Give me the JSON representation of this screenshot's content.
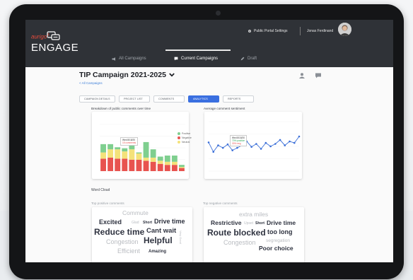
{
  "app": {
    "brand_small": "aurigo",
    "brand_big": "ENGAGE",
    "settings_label": "Public Portal Settings",
    "user_name": "Jonas Ferdinand"
  },
  "nav": {
    "tabs": [
      {
        "label": "All Campaigns"
      },
      {
        "label": "Current Campaigns"
      },
      {
        "label": "Draft"
      }
    ],
    "active_tab": 1
  },
  "page": {
    "title": "TIP Campaign 2021-2025",
    "back_link": "< All Campaigns",
    "pills": [
      "CAMPAIGN DETAILS",
      "PROJECT LIST",
      "COMMENTS",
      "ANALYTICS",
      "REPORTS"
    ],
    "active_pill": 3
  },
  "sections": {
    "breakdown_title": "Breakdown of public comments over time",
    "sentiment_title": "Average comment sentiment",
    "word_cloud_title": "Word Cloud",
    "top_positive_title": "Top positive comments",
    "top_negative_title": "Top negative comments"
  },
  "colors": {
    "positive": "#7fcf8f",
    "negative": "#e8534f",
    "neutral": "#f4e27a",
    "accent": "#3a6fe0",
    "line": "#3b6fd8"
  },
  "chart_data": [
    {
      "type": "bar",
      "stacked": true,
      "title": "Breakdown of public comments over time",
      "legend": [
        "Positive",
        "Negative",
        "Neutral"
      ],
      "legend_placement": "top-right",
      "series": [
        {
          "name": "Negative",
          "values": [
            12,
            13,
            12,
            12,
            11,
            11,
            10,
            9,
            7,
            6,
            6,
            3
          ]
        },
        {
          "name": "Neutral",
          "values": [
            6,
            8,
            9,
            7,
            10,
            6,
            3,
            4,
            3,
            3,
            3,
            1
          ]
        },
        {
          "name": "Positive",
          "values": [
            8,
            5,
            2,
            3,
            4,
            1,
            15,
            8,
            4,
            6,
            6,
            2
          ]
        }
      ],
      "ylim": [
        0,
        45
      ],
      "tooltip": {
        "line1": "Wed 8/18/20",
        "line2": "15 comments"
      }
    },
    {
      "type": "line",
      "title": "Average comment sentiment",
      "values": [
        0.58,
        0.39,
        0.52,
        0.47,
        0.54,
        0.42,
        0.47,
        0.52,
        0.6,
        0.49,
        0.55,
        0.45,
        0.57,
        0.5,
        0.55,
        0.63,
        0.52,
        0.6,
        0.57,
        0.7
      ],
      "ylim": [
        0,
        1
      ],
      "tooltip": {
        "line1": "Wed 8/18/20",
        "line2": "70% positive",
        "line3": "30% neg"
      }
    }
  ],
  "word_clouds": {
    "positive": [
      "Commute",
      "Excited",
      "Glad",
      "Short",
      "Drive time",
      "Reduce time",
      "Cant wait",
      "Congestion",
      "Helpful",
      "Efficient",
      "Amazing",
      "Very Good"
    ],
    "negative": [
      "extra miles",
      "Restrictive",
      "Upset",
      "Short",
      "Drive time",
      "Route blocked",
      "too long",
      "Congestion",
      "segregation",
      "Poor choice"
    ]
  }
}
